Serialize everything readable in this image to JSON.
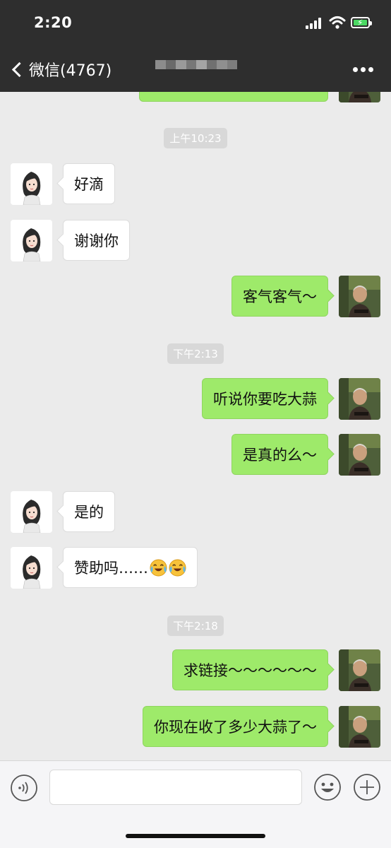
{
  "status_bar": {
    "time": "2:20"
  },
  "header": {
    "back_label": "微信(4767)",
    "contact_name_blurred": true
  },
  "messages": [
    {
      "side": "right",
      "text": "",
      "partial": true
    },
    {
      "type": "timestamp",
      "text": "上午10:23"
    },
    {
      "side": "left",
      "text": "好滴"
    },
    {
      "side": "left",
      "text": "谢谢你"
    },
    {
      "side": "right",
      "text": "客气客气～"
    },
    {
      "type": "timestamp",
      "text": "下午2:13"
    },
    {
      "side": "right",
      "text": "听说你要吃大蒜"
    },
    {
      "side": "right",
      "text": "是真的么～"
    },
    {
      "side": "left",
      "text": "是的"
    },
    {
      "side": "left",
      "text": "赞助吗……",
      "emojis": [
        "laugh-cry-icon",
        "laugh-cry-icon"
      ]
    },
    {
      "type": "timestamp",
      "text": "下午2:18"
    },
    {
      "side": "right",
      "text": "求链接～～～～～～"
    },
    {
      "side": "right",
      "text": "你现在收了多少大蒜了～"
    }
  ],
  "input_bar": {
    "placeholder": "",
    "value": ""
  },
  "colors": {
    "header_bg": "#2e2e2e",
    "chat_bg": "#ebebeb",
    "right_bubble": "#9eea6a",
    "left_bubble": "#ffffff",
    "battery": "#4cd964"
  }
}
